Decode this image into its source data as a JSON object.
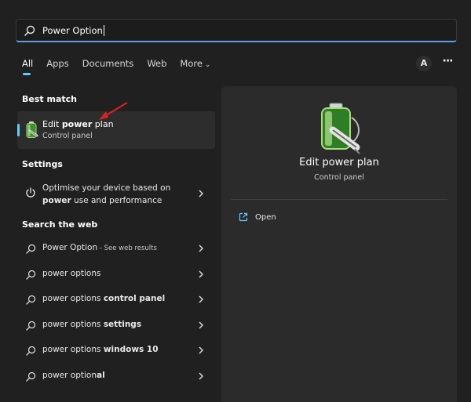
{
  "search": {
    "value": "Power Option"
  },
  "tabs": [
    {
      "label": "All",
      "active": true
    },
    {
      "label": "Apps"
    },
    {
      "label": "Documents"
    },
    {
      "label": "Web"
    },
    {
      "label": "More"
    }
  ],
  "account": {
    "avatar_letter": "A",
    "more_label": "···"
  },
  "sections": {
    "best_match": "Best match",
    "settings": "Settings",
    "search_web": "Search the web"
  },
  "best_match": {
    "title_pre": "Edit ",
    "title_bold": "power",
    "title_post": " plan",
    "subtitle": "Control panel"
  },
  "settings_item": {
    "line1": "Optimise your device based on",
    "line2_bold": "power",
    "line2_rest": " use and performance"
  },
  "web_results": [
    {
      "pre": "Power Option",
      "bold": "",
      "small": " - See web results"
    },
    {
      "pre": "power options",
      "bold": "",
      "small": ""
    },
    {
      "pre": "power options ",
      "bold": "control panel",
      "small": ""
    },
    {
      "pre": "power options ",
      "bold": "settings",
      "small": ""
    },
    {
      "pre": "power options ",
      "bold": "windows 10",
      "small": ""
    },
    {
      "pre": "power option",
      "bold": "al",
      "small": ""
    }
  ],
  "detail": {
    "title": "Edit power plan",
    "subtitle": "Control panel",
    "open_label": "Open"
  },
  "colors": {
    "accent": "#60cdff",
    "arrow": "#e02020"
  }
}
